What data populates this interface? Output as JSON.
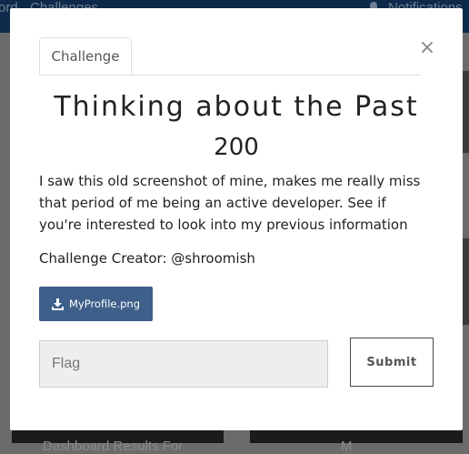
{
  "navbar": {
    "links": [
      "ord",
      "Challenges"
    ],
    "notifications_label": "Notifications"
  },
  "background": {
    "card_left_label": "Dashboard Results For",
    "card_right_label": "M"
  },
  "modal": {
    "tab_label": "Challenge",
    "close_glyph": "×",
    "title": "Thinking about the Past",
    "points": "200",
    "description": "I saw this old screenshot of mine, makes me really miss that period of me being an active developer. See if you're interested to look into my previous information",
    "creator": "Challenge Creator: @shroomish",
    "file_button_label": "MyProfile.png",
    "file_button_icon": "download-icon",
    "flag_placeholder": "Flag",
    "flag_value": "",
    "submit_label": "Submit"
  },
  "colors": {
    "navbar": "#0d2a4a",
    "overlay": "#6b6b6b",
    "file_button": "#3e5f8a",
    "input_bg": "#eeeeee"
  }
}
